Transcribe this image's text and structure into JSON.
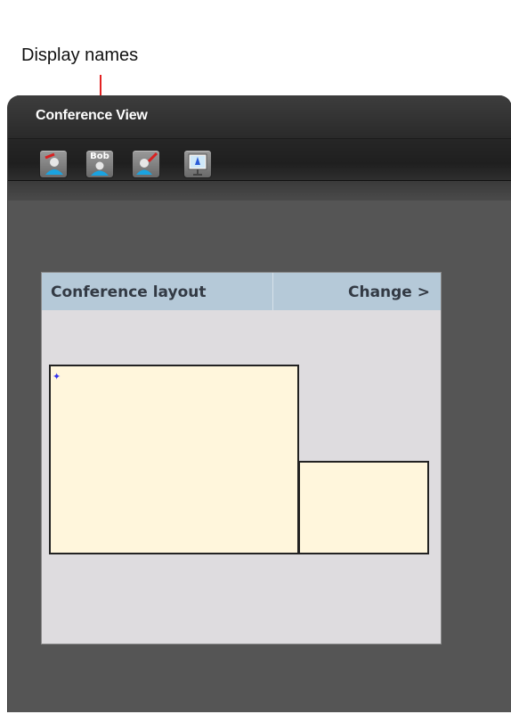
{
  "annotation": {
    "label": "Display names",
    "arrow_color": "#e32222"
  },
  "panel": {
    "title": "Conference View",
    "toolbar": [
      {
        "icon": "participant-red-badge-icon",
        "label": ""
      },
      {
        "icon": "participant-display-name-icon",
        "label": "Bob"
      },
      {
        "icon": "participant-pencil-icon",
        "label": ""
      },
      {
        "icon": "presentation-screen-icon",
        "label": ""
      }
    ]
  },
  "layout": {
    "title": "Conference layout",
    "change_label": "Change >",
    "header_color": "#b5c9d8",
    "cell_color": "#fff6dc",
    "marker_color": "#3333ee"
  }
}
